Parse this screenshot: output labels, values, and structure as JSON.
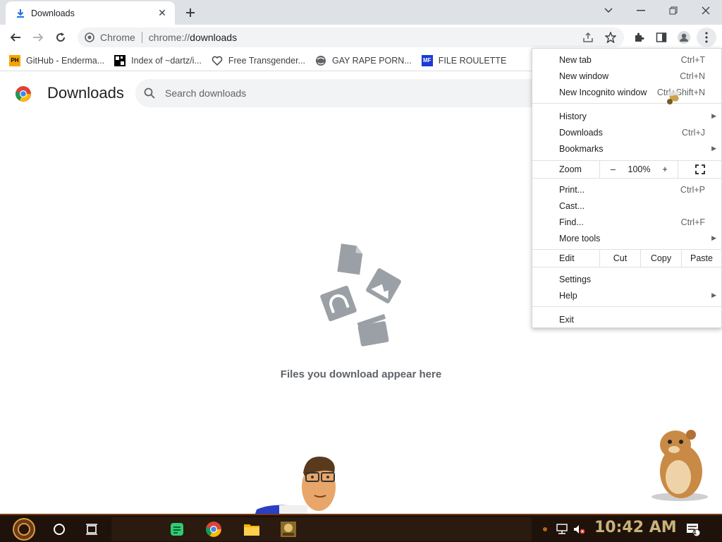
{
  "window": {
    "tab_title": "Downloads",
    "minimize_label": "–",
    "restore_label": "❐",
    "close_label": "✕"
  },
  "omnibox": {
    "site_label": "Chrome",
    "url_scheme": "chrome://",
    "url_host": "downloads"
  },
  "bookmarks": [
    {
      "label": "GitHub - Enderma...",
      "favicon": "PH",
      "color": "#f7a400"
    },
    {
      "label": "Index of ~dartz/i...",
      "favicon": "grid",
      "color": "#000000"
    },
    {
      "label": "Free Transgender...",
      "favicon": "heart",
      "color": "#444444"
    },
    {
      "label": "GAY RAPE PORN...",
      "favicon": "globe",
      "color": "#5f6368"
    },
    {
      "label": "FILE ROULETTE",
      "favicon": "MF",
      "color": "#1a3ad6"
    }
  ],
  "page": {
    "title": "Downloads",
    "search_placeholder": "Search downloads",
    "empty_message": "Files you download appear here"
  },
  "menu": {
    "new_tab": {
      "label": "New tab",
      "shortcut": "Ctrl+T"
    },
    "new_window": {
      "label": "New window",
      "shortcut": "Ctrl+N"
    },
    "new_incognito": {
      "label": "New Incognito window",
      "shortcut": "Ctrl+Shift+N"
    },
    "history": {
      "label": "History"
    },
    "downloads": {
      "label": "Downloads",
      "shortcut": "Ctrl+J"
    },
    "bookmarks": {
      "label": "Bookmarks"
    },
    "zoom": {
      "label": "Zoom",
      "minus": "–",
      "value": "100%",
      "plus": "+"
    },
    "print": {
      "label": "Print...",
      "shortcut": "Ctrl+P"
    },
    "cast": {
      "label": "Cast..."
    },
    "find": {
      "label": "Find...",
      "shortcut": "Ctrl+F"
    },
    "more_tools": {
      "label": "More tools"
    },
    "edit": {
      "label": "Edit",
      "cut": "Cut",
      "copy": "Copy",
      "paste": "Paste"
    },
    "settings": {
      "label": "Settings"
    },
    "help": {
      "label": "Help"
    },
    "exit": {
      "label": "Exit"
    }
  },
  "taskbar": {
    "clock": "10:42 AM",
    "notification_count": "1"
  },
  "colors": {
    "accent": "#1a73e8",
    "tabbar": "#dee1e6",
    "taskbar": "#1f120a",
    "clock": "#c9b27a"
  }
}
